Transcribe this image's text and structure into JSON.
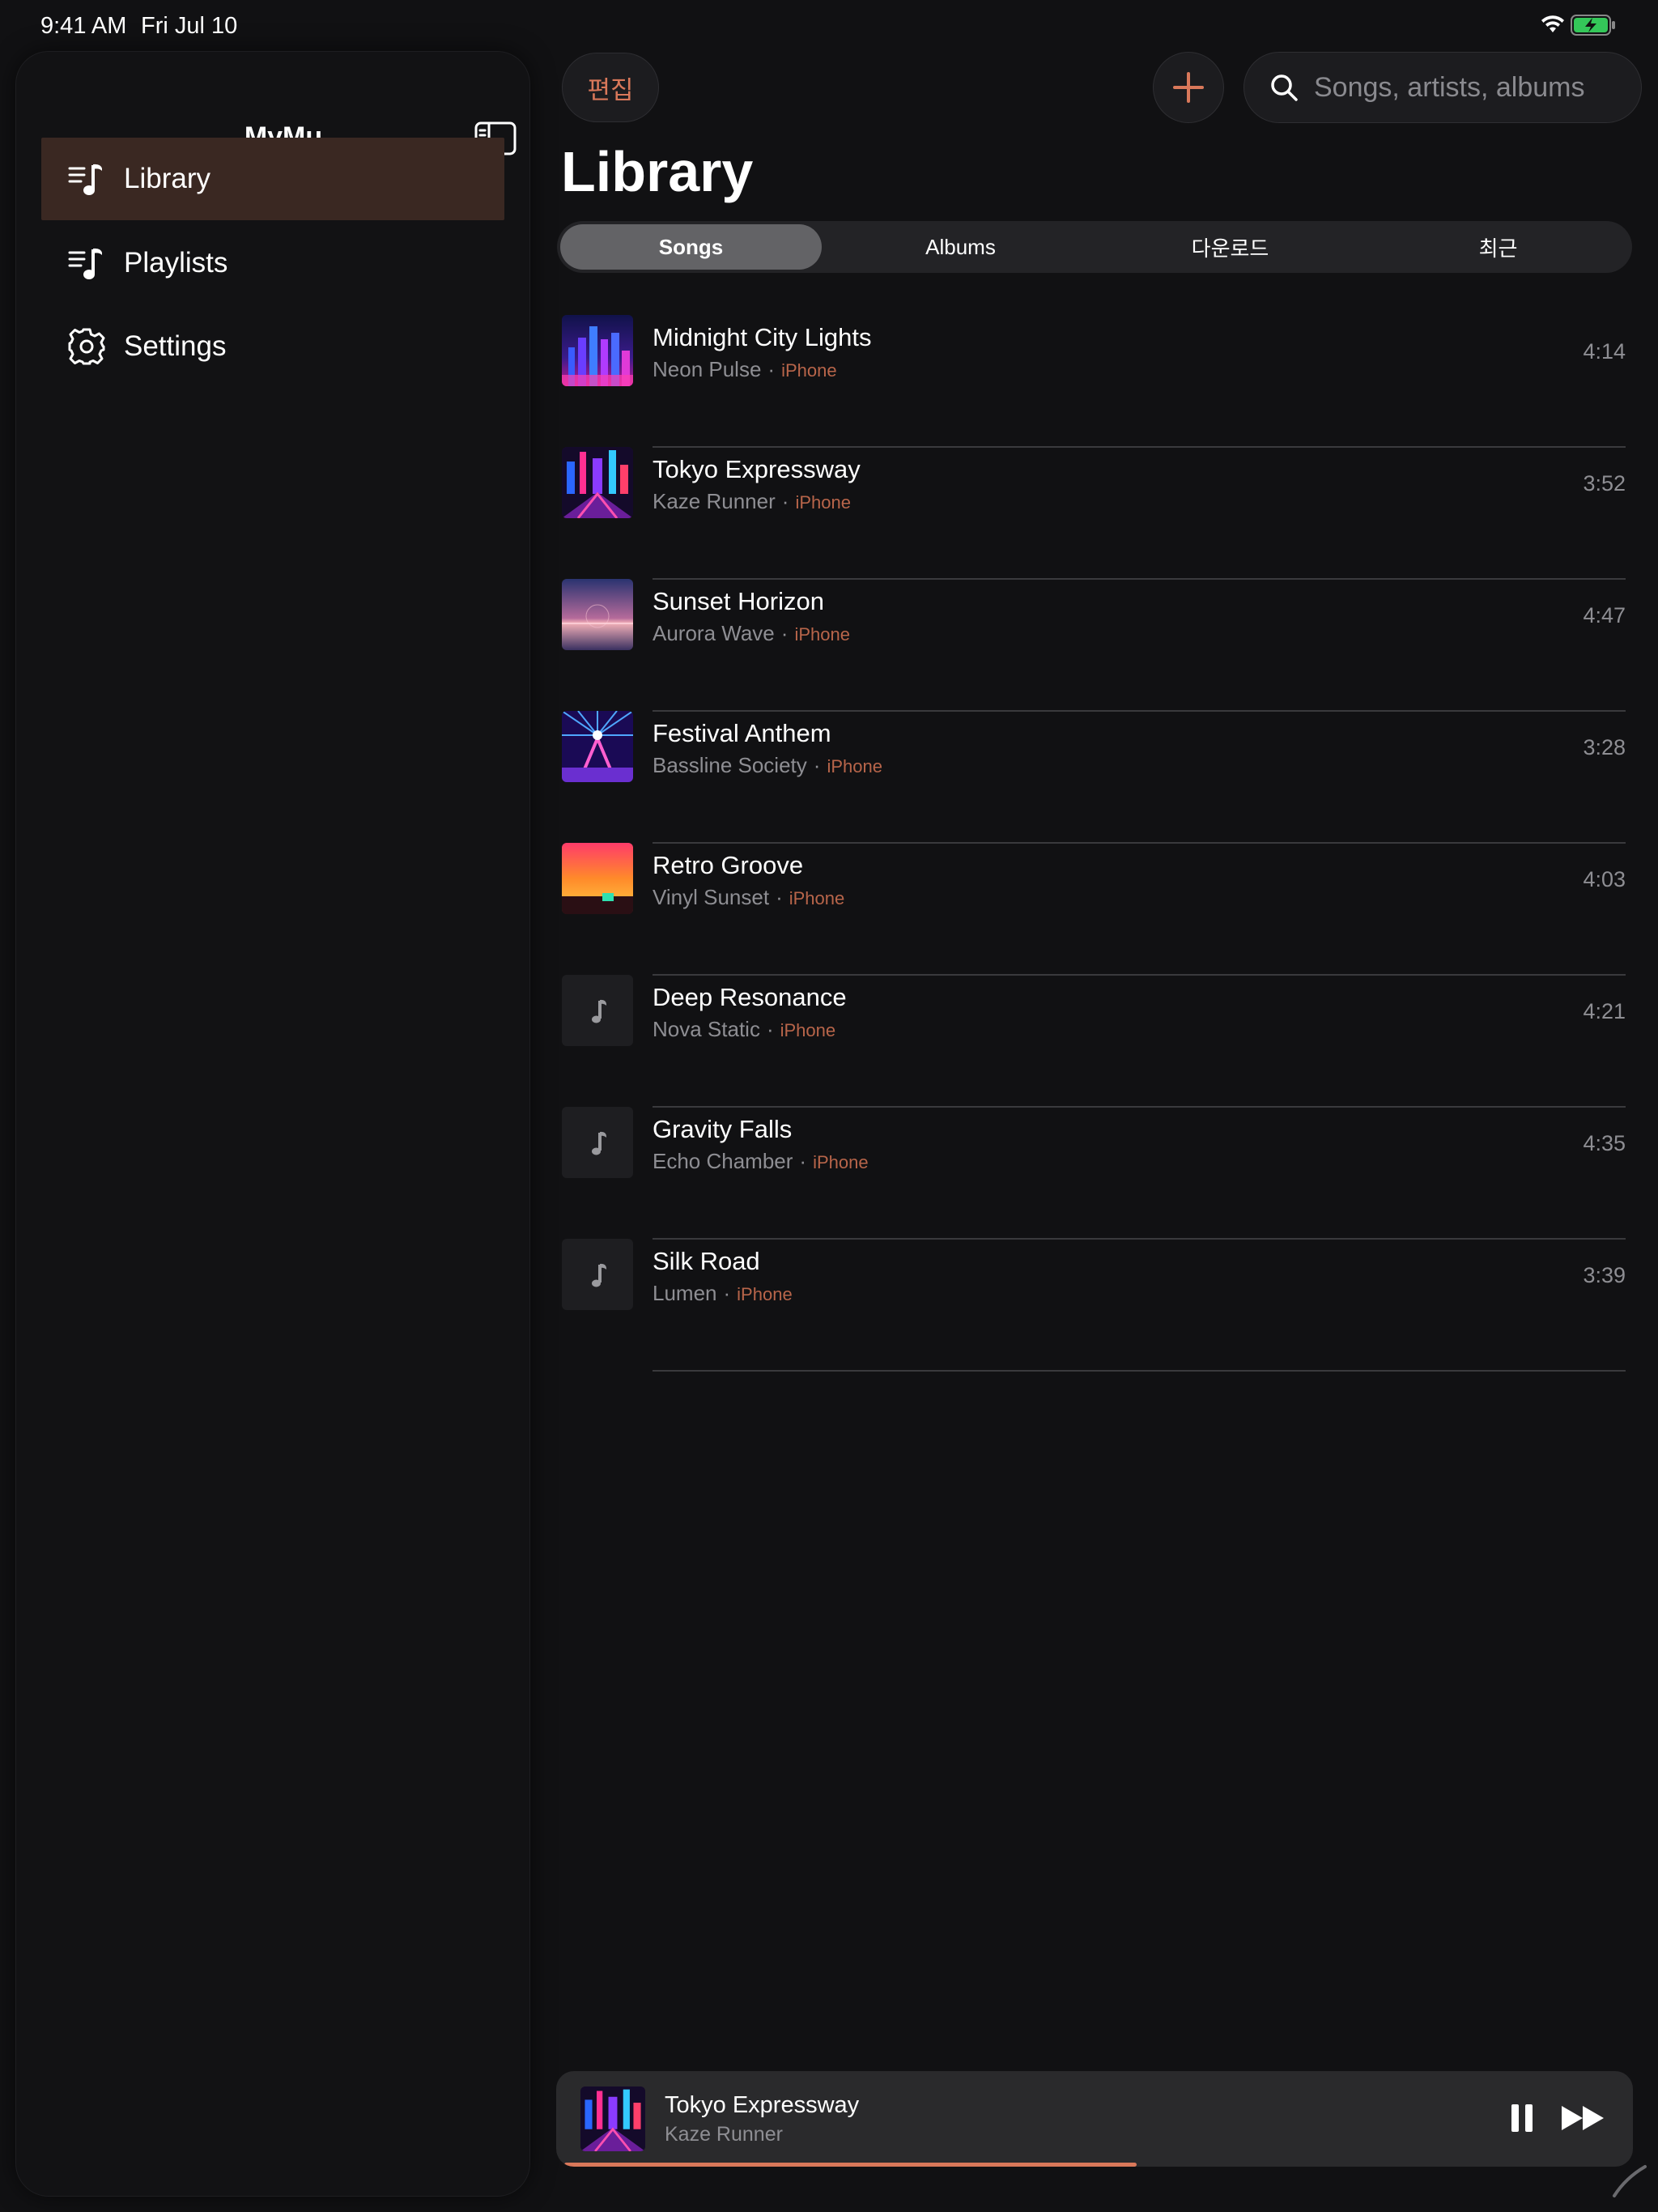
{
  "status_bar": {
    "time": "9:41 AM",
    "date": "Fri Jul 10",
    "wifi_icon": "wifi-icon",
    "battery_icon": "battery-charging-icon"
  },
  "sidebar": {
    "title": "MyMu",
    "toggle_icon": "sidebar-toggle-icon",
    "items": [
      {
        "label": "Library",
        "icon": "music-list-icon",
        "active": true
      },
      {
        "label": "Playlists",
        "icon": "music-list-icon",
        "active": false
      },
      {
        "label": "Settings",
        "icon": "gear-icon",
        "active": false
      }
    ]
  },
  "toolbar": {
    "edit_label": "편집",
    "add_icon": "plus-icon",
    "search_placeholder": "Songs, artists, albums"
  },
  "main": {
    "title": "Library",
    "tabs": [
      {
        "label": "Songs",
        "active": true
      },
      {
        "label": "Albums",
        "active": false
      },
      {
        "label": "다운로드",
        "active": false
      },
      {
        "label": "최근",
        "active": false
      }
    ],
    "songs": [
      {
        "title": "Midnight City Lights",
        "artist": "Neon Pulse",
        "source": "iPhone",
        "duration": "4:14",
        "art": "neon-city"
      },
      {
        "title": "Tokyo Expressway",
        "artist": "Kaze Runner",
        "source": "iPhone",
        "duration": "3:52",
        "art": "tokyo"
      },
      {
        "title": "Sunset Horizon",
        "artist": "Aurora Wave",
        "source": "iPhone",
        "duration": "4:47",
        "art": "sunset-sea"
      },
      {
        "title": "Festival Anthem",
        "artist": "Bassline Society",
        "source": "iPhone",
        "duration": "3:28",
        "art": "festival"
      },
      {
        "title": "Retro Groove",
        "artist": "Vinyl Sunset",
        "source": "iPhone",
        "duration": "4:03",
        "art": "retro"
      },
      {
        "title": "Deep Resonance",
        "artist": "Nova Static",
        "source": "iPhone",
        "duration": "4:21",
        "art": "placeholder"
      },
      {
        "title": "Gravity Falls",
        "artist": "Echo Chamber",
        "source": "iPhone",
        "duration": "4:35",
        "art": "placeholder"
      },
      {
        "title": "Silk Road",
        "artist": "Lumen",
        "source": "iPhone",
        "duration": "3:39",
        "art": "placeholder"
      }
    ]
  },
  "now_playing": {
    "title": "Tokyo Expressway",
    "artist": "Kaze Runner",
    "progress": 0.54,
    "pause_icon": "pause-icon",
    "next_icon": "fast-forward-icon"
  },
  "colors": {
    "accent": "#d9785a",
    "background": "#111113",
    "active_nav": "#3a2822"
  }
}
